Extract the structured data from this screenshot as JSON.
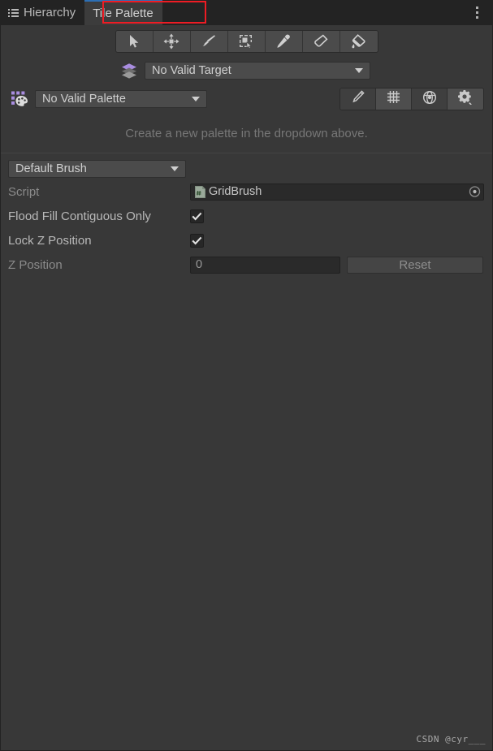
{
  "window": {
    "background_color": "#383838",
    "tabbar_color": "#232323",
    "accent_color": "#2c6fb5",
    "annotation_color": "#ee1c24"
  },
  "tabbar": {
    "tabs": [
      {
        "label": "Hierarchy",
        "icon": "hierarchy-icon",
        "active": false
      },
      {
        "label": "Tile Palette",
        "icon": "",
        "active": true
      }
    ],
    "menu_icon": "kebab-menu-icon"
  },
  "toolbar": {
    "tools": [
      {
        "name": "select-tool",
        "icon": "cursor-arrow-icon"
      },
      {
        "name": "move-tool",
        "icon": "move-arrows-icon"
      },
      {
        "name": "paint-tool",
        "icon": "paintbrush-icon"
      },
      {
        "name": "box-fill-tool",
        "icon": "box-select-icon"
      },
      {
        "name": "picker-tool",
        "icon": "eyedropper-icon"
      },
      {
        "name": "erase-tool",
        "icon": "eraser-icon"
      },
      {
        "name": "fill-tool",
        "icon": "paint-bucket-icon"
      }
    ]
  },
  "target": {
    "icon": "tilemap-layers-icon",
    "value": "No Valid Target"
  },
  "palette": {
    "icon": "tile-palette-icon",
    "value": "No Valid Palette",
    "buttons": [
      {
        "name": "edit-palette-button",
        "icon": "pencil-icon",
        "active": false
      },
      {
        "name": "grid-toggle-button",
        "icon": "grid-icon",
        "active": true
      },
      {
        "name": "gizmos-button",
        "icon": "gizmo-globe-icon",
        "active": false
      },
      {
        "name": "settings-button",
        "icon": "gear-icon",
        "active": true
      }
    ],
    "empty_hint": "Create a new palette in the dropdown above."
  },
  "brush_inspector": {
    "brush_selector": {
      "value": "Default Brush"
    },
    "fields": [
      {
        "label": "Script",
        "label_dim": true,
        "type": "object",
        "value": "GridBrush",
        "icon": "cs-script-icon",
        "picker_icon": "object-picker-icon"
      },
      {
        "label": "Flood Fill Contiguous Only",
        "label_dim": false,
        "type": "checkbox",
        "checked": true
      },
      {
        "label": "Lock Z Position",
        "label_dim": false,
        "type": "checkbox",
        "checked": true
      },
      {
        "label": "Z Position",
        "label_dim": true,
        "type": "number",
        "value": "0",
        "button_label": "Reset"
      }
    ]
  },
  "watermark": {
    "text": "CSDN @cyr___"
  }
}
